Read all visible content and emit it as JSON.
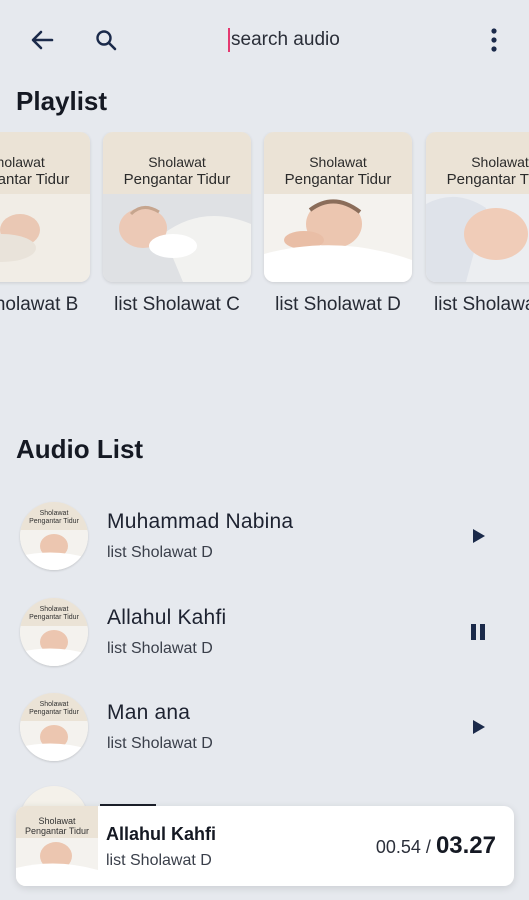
{
  "topbar": {
    "search_placeholder": "search audio",
    "back_icon": "arrow-left-icon",
    "search_icon": "magnifier-icon",
    "more_icon": "kebab-menu-icon"
  },
  "playlist": {
    "title": "Playlist",
    "cover_line1": "Sholawat",
    "cover_line2": "Pengantar Tidur",
    "items": [
      {
        "label": "list Sholawat B"
      },
      {
        "label": "list Sholawat C"
      },
      {
        "label": "list Sholawat D"
      },
      {
        "label": "list Sholawat E"
      }
    ]
  },
  "audio_list": {
    "title": "Audio List",
    "cover_line1": "Sholawat",
    "cover_line2": "Pengantar Tidur",
    "items": [
      {
        "title": "Muhammad Nabina",
        "subtitle": "list Sholawat D",
        "state": "play"
      },
      {
        "title": "Allahul Kahfi",
        "subtitle": "list Sholawat D",
        "state": "pause"
      },
      {
        "title": "Man ana",
        "subtitle": "list Sholawat D",
        "state": "play"
      }
    ]
  },
  "player": {
    "title": "Allahul Kahfi",
    "subtitle": "list Sholawat D",
    "current_time": "00.54",
    "separator": "/",
    "total_time": "03.27"
  },
  "colors": {
    "background": "#e6e9ee",
    "accent_caret": "#e53970",
    "icon_dark": "#1b2a4a"
  }
}
